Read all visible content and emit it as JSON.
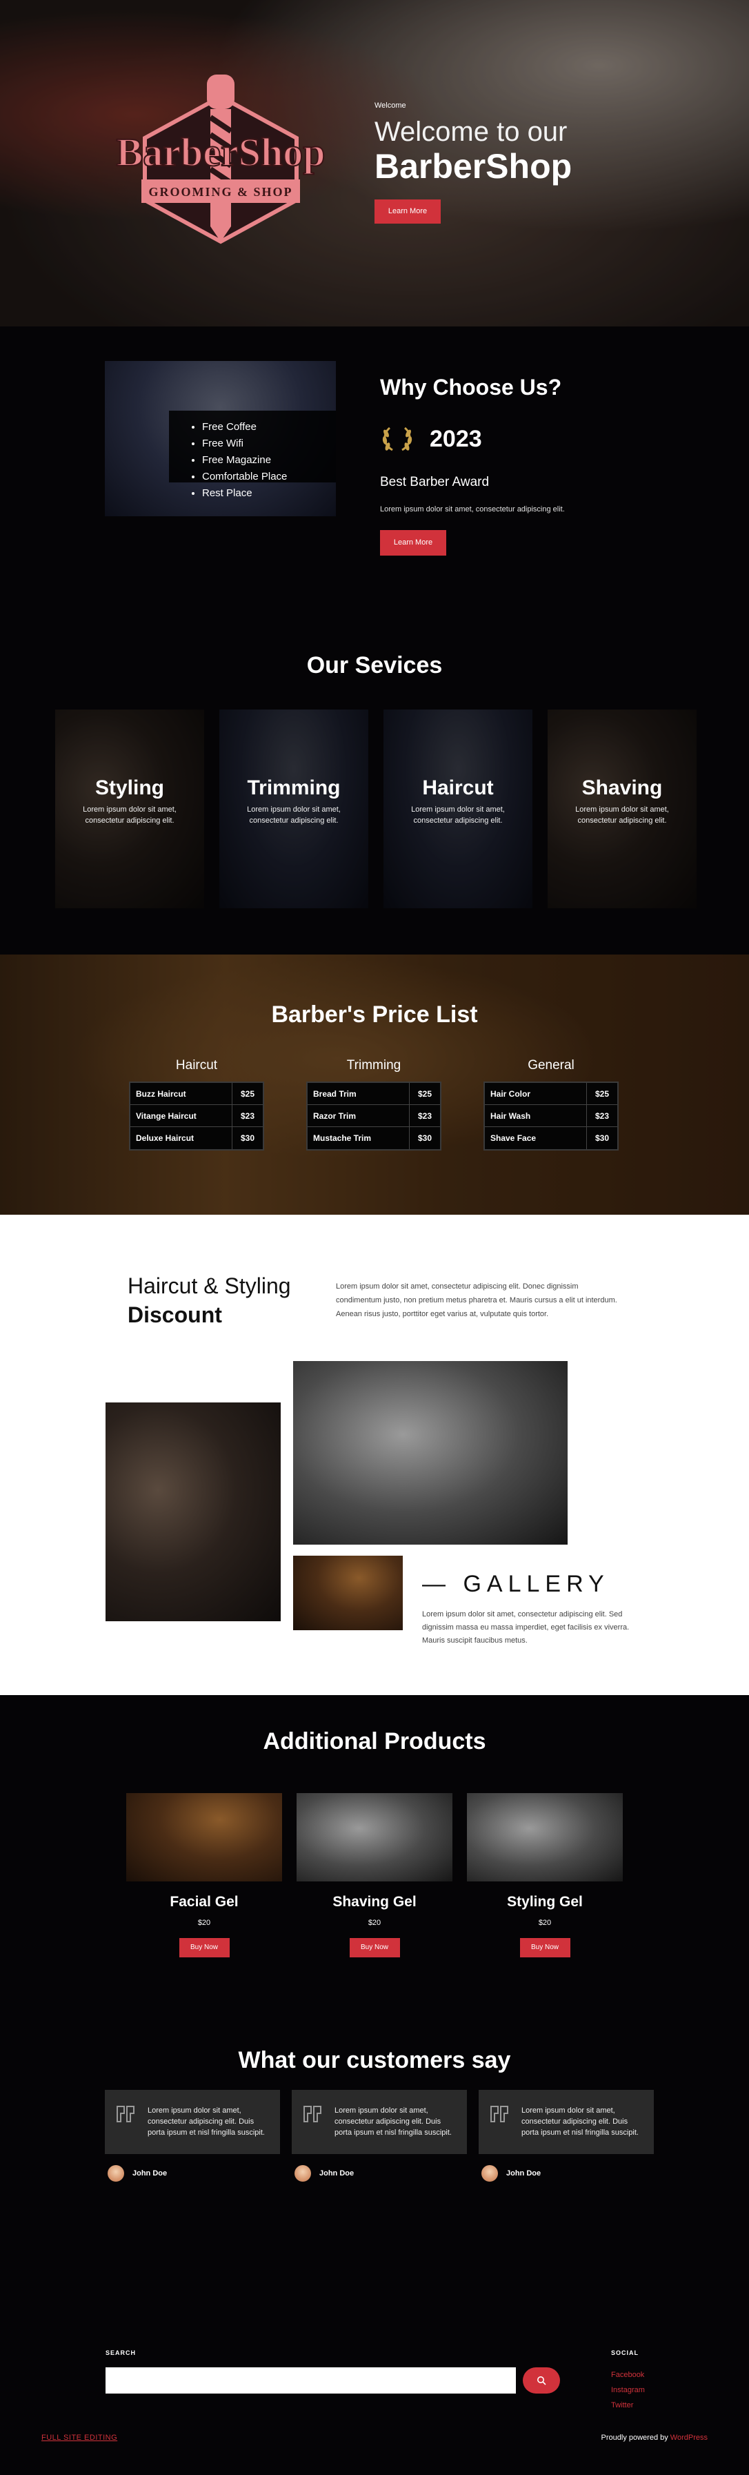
{
  "hero": {
    "logo_title": "BarberShop",
    "logo_subtitle": "GROOMING & SHOP",
    "welcome": "Welcome",
    "headline_light": "Welcome to our",
    "headline_bold": "BarberShop",
    "button": "Learn More"
  },
  "why": {
    "features": [
      "Free Coffee",
      "Free Wifi",
      "Free Magazine",
      "Comfortable Place",
      "Rest Place"
    ],
    "title": "Why Choose Us?",
    "award_year": "2023",
    "award_name": "Best Barber Award",
    "description": "Lorem ipsum dolor sit amet, consectetur adipiscing elit.",
    "button": "Learn More"
  },
  "services": {
    "title": "Our Sevices",
    "items": [
      {
        "name": "Styling",
        "desc": "Lorem ipsum dolor sit amet, consectetur adipiscing elit."
      },
      {
        "name": "Trimming",
        "desc": "Lorem ipsum dolor sit amet, consectetur adipiscing elit."
      },
      {
        "name": "Haircut",
        "desc": "Lorem ipsum dolor sit amet, consectetur adipiscing elit."
      },
      {
        "name": "Shaving",
        "desc": "Lorem ipsum dolor sit amet, consectetur adipiscing elit."
      }
    ]
  },
  "price_list": {
    "title": "Barber's Price List",
    "columns": [
      {
        "title": "Haircut",
        "rows": [
          {
            "item": "Buzz Haircut",
            "price": "$25"
          },
          {
            "item": "Vitange Haircut",
            "price": "$23"
          },
          {
            "item": "Deluxe Haircut",
            "price": "$30"
          }
        ]
      },
      {
        "title": "Trimming",
        "rows": [
          {
            "item": "Bread Trim",
            "price": "$25"
          },
          {
            "item": "Razor Trim",
            "price": "$23"
          },
          {
            "item": "Mustache Trim",
            "price": "$30"
          }
        ]
      },
      {
        "title": "General",
        "rows": [
          {
            "item": "Hair Color",
            "price": "$25"
          },
          {
            "item": "Hair Wash",
            "price": "$23"
          },
          {
            "item": "Shave Face",
            "price": "$30"
          }
        ]
      }
    ]
  },
  "discount": {
    "title_light": "Haircut & Styling",
    "title_bold": "Discount",
    "text": "Lorem ipsum dolor sit amet, consectetur adipiscing elit. Donec dignissim condimentum justo, non pretium metus pharetra et. Mauris cursus a elit ut interdum. Aenean risus justo, porttitor eget varius at, vulputate quis tortor."
  },
  "gallery": {
    "title": "— GALLERY",
    "text": "Lorem ipsum dolor sit amet, consectetur adipiscing elit. Sed dignissim massa eu massa imperdiet, eget facilisis ex viverra. Mauris suscipit faucibus metus."
  },
  "products": {
    "title": "Additional Products",
    "items": [
      {
        "name": "Facial Gel",
        "price": "$20",
        "button": "Buy Now"
      },
      {
        "name": "Shaving Gel",
        "price": "$20",
        "button": "Buy Now"
      },
      {
        "name": "Styling Gel",
        "price": "$20",
        "button": "Buy Now"
      }
    ]
  },
  "testimonials": {
    "title": "What our customers say",
    "items": [
      {
        "text": "Lorem ipsum dolor sit amet, consectetur adipiscing elit. Duis porta ipsum et nisl fringilla suscipit.",
        "author": "John Doe"
      },
      {
        "text": "Lorem ipsum dolor sit amet, consectetur adipiscing elit. Duis porta ipsum et nisl fringilla suscipit.",
        "author": "John Doe"
      },
      {
        "text": "Lorem ipsum dolor sit amet, consectetur adipiscing elit. Duis porta ipsum et nisl fringilla suscipit.",
        "author": "John Doe"
      }
    ]
  },
  "footer": {
    "search_label": "SEARCH",
    "search_value": "",
    "social_label": "SOCIAL",
    "social_links": [
      "Facebook",
      "Instagram",
      "Twitter"
    ],
    "full_site_editing": "FULL SITE EDITING",
    "powered_prefix": "Proudly powered by ",
    "powered_link": "WordPress"
  },
  "colors": {
    "accent": "#d1323b",
    "background": "#050406",
    "logo_pink": "#e8858a"
  },
  "icons": [
    "laurel-icon",
    "quote-icon",
    "search-icon"
  ]
}
